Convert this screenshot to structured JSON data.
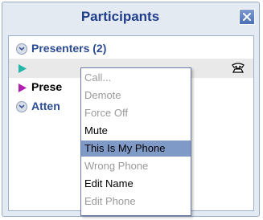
{
  "panel": {
    "title": "Participants",
    "close_icon": "close-icon"
  },
  "groups": {
    "presenters": {
      "label": "Presenters (2)",
      "icon": "chevron-down-icon"
    },
    "attendees": {
      "label": "Atten",
      "icon": "chevron-down-icon"
    }
  },
  "participants": [
    {
      "name": "",
      "color": "#1fb8a8",
      "icon": "play-icon",
      "trailing_icon": "phone-icon"
    },
    {
      "name": "Prese",
      "color": "#b01fb0",
      "icon": "play-icon"
    }
  ],
  "context_menu": {
    "items": [
      {
        "label": "Call...",
        "state": "disabled"
      },
      {
        "label": "Demote",
        "state": "disabled"
      },
      {
        "label": "Force Off",
        "state": "disabled"
      },
      {
        "label": "Mute",
        "state": "enabled"
      },
      {
        "label": "This Is My Phone",
        "state": "highlighted"
      },
      {
        "label": "Wrong Phone",
        "state": "disabled"
      },
      {
        "label": "Edit Name",
        "state": "enabled"
      },
      {
        "label": "Edit Phone",
        "state": "disabled"
      }
    ]
  }
}
